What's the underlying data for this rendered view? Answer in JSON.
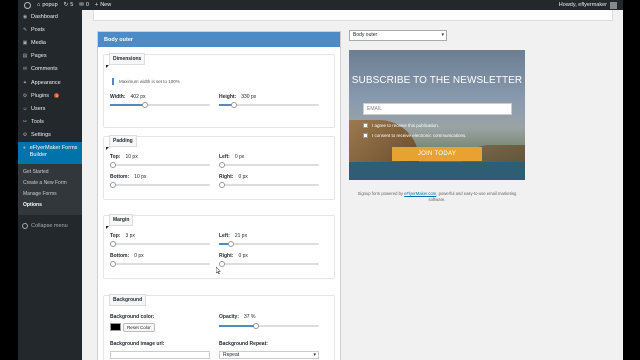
{
  "adminbar": {
    "site_name": "popup",
    "updates": "5",
    "comments": "0",
    "new_label": "New",
    "howdy": "Howdy, eflyermaker"
  },
  "sidebar": {
    "items": [
      {
        "label": "Dashboard",
        "icon": "dashboard-icon",
        "glyph": "◉"
      },
      {
        "label": "Posts",
        "icon": "pin-icon",
        "glyph": "✎"
      },
      {
        "label": "Media",
        "icon": "media-icon",
        "glyph": "▣"
      },
      {
        "label": "Pages",
        "icon": "page-icon",
        "glyph": "▤"
      },
      {
        "label": "Comments",
        "icon": "comment-icon",
        "glyph": "✉"
      },
      {
        "label": "Appearance",
        "icon": "brush-icon",
        "glyph": "✦"
      },
      {
        "label": "Plugins",
        "icon": "plug-icon",
        "glyph": "⚙",
        "badge": "5"
      },
      {
        "label": "Users",
        "icon": "user-icon",
        "glyph": "☺"
      },
      {
        "label": "Tools",
        "icon": "wrench-icon",
        "glyph": "✂"
      },
      {
        "label": "Settings",
        "icon": "settings-icon",
        "glyph": "⚙"
      }
    ],
    "active": {
      "label": "eFlyerMaker Forms Builder",
      "icon": "eflyermaker-icon"
    },
    "submenu": [
      "Get Started",
      "Create a New Form",
      "Manage Forms",
      "Options"
    ],
    "collapse_label": "Collapse menu"
  },
  "panel": {
    "title": "Body outer",
    "dimensions": {
      "title": "Dimensions",
      "notice": "Maximum width is set to 100%",
      "width_label": "Width:",
      "width_value": "402 px",
      "width_level": 0.35,
      "height_label": "Height:",
      "height_value": "330 px",
      "height_level": 0.15
    },
    "padding": {
      "title": "Padding",
      "top_label": "Top:",
      "top_value": "10 px",
      "top_level": 0.02,
      "left_label": "Left:",
      "left_value": "0 px",
      "left_level": 0.0,
      "bottom_label": "Bottom:",
      "bottom_value": "10 px",
      "bottom_level": 0.02,
      "right_label": "Right:",
      "right_value": "0 px",
      "right_level": 0.0
    },
    "margin": {
      "title": "Margin",
      "top_label": "Top:",
      "top_value": "3 px",
      "top_level": 0.01,
      "left_label": "Left:",
      "left_value": "21 px",
      "left_level": 0.12,
      "bottom_label": "Bottom:",
      "bottom_value": "0 px",
      "bottom_level": 0.0,
      "right_label": "Right:",
      "right_value": "0 px",
      "right_level": 0.0
    },
    "background": {
      "title": "Background",
      "color_label": "Background color:",
      "color_value": "#000000",
      "clear_button": "Reset Color",
      "opacity_label": "Opacity:",
      "opacity_value": "37 %",
      "opacity_level": 0.37,
      "image_label": "Background image url:",
      "repeat_label": "Background Repeat:",
      "repeat_value": "Repeat"
    }
  },
  "preview": {
    "select_value": "Body outer",
    "newsletter": {
      "title": "SUBSCRIBE TO THE NEWSLETTER",
      "email_placeholder": "EMAIL",
      "check1": "I agree to receive this publication.",
      "check2": "I consent to receive electronic communications.",
      "button": "JOIN TODAY",
      "button_color": "#e8a232"
    },
    "powered_prefix": "Signup form powered by ",
    "powered_link": "eFlyerMaker.com",
    "powered_suffix": ", powerful and easy-to-use email marketing software."
  },
  "colors": {
    "accent": "#4d8bc7",
    "admin_dark": "#23282d",
    "active_menu": "#0073aa"
  }
}
